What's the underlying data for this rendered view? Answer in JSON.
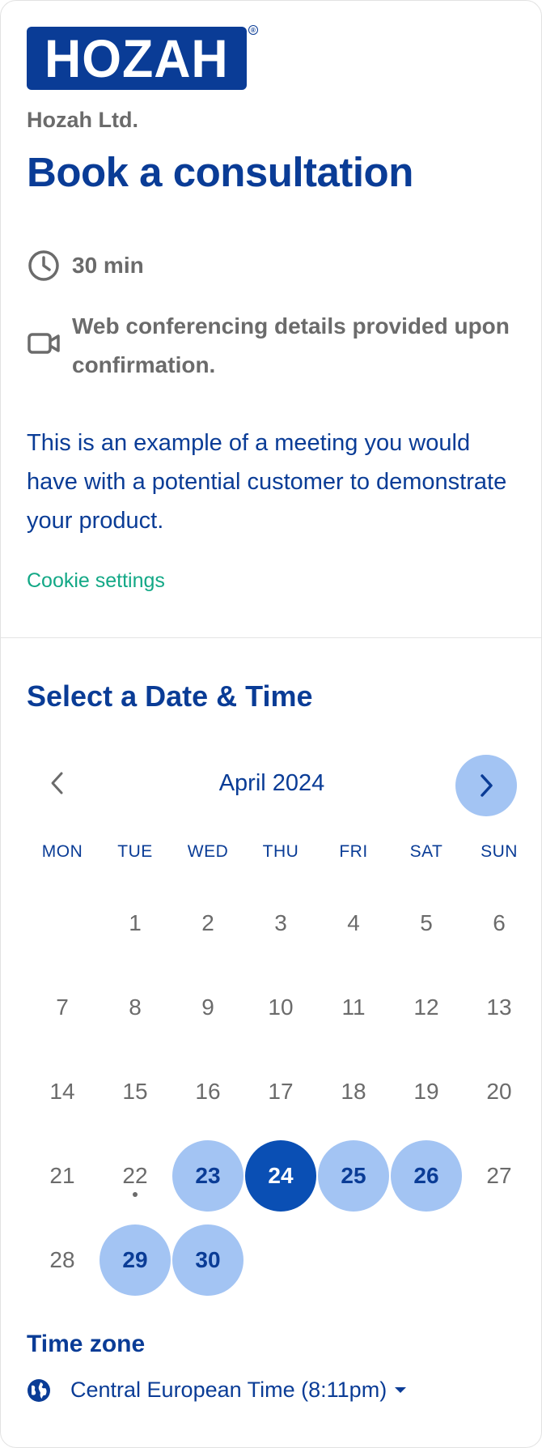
{
  "logo": {
    "text": "HOZAH",
    "reg": "®"
  },
  "organizer": "Hozah Ltd.",
  "event_title": "Book a consultation",
  "duration": {
    "icon": "clock-icon",
    "label": "30 min"
  },
  "location": {
    "icon": "video-camera-icon",
    "label": "Web conferencing details provided upon confirmation."
  },
  "description": "This is an example of a meeting you would have with a potential customer to demonstrate your product.",
  "cookie_link": "Cookie settings",
  "calendar": {
    "heading": "Select a Date & Time",
    "month_label": "April 2024",
    "prev_icon": "chevron-left-icon",
    "next_icon": "chevron-right-icon",
    "weekdays": [
      "MON",
      "TUE",
      "WED",
      "THU",
      "FRI",
      "SAT",
      "SUN"
    ],
    "days": [
      "1",
      "2",
      "3",
      "4",
      "5",
      "6",
      "7",
      "8",
      "9",
      "10",
      "11",
      "12",
      "13",
      "14",
      "15",
      "16",
      "17",
      "18",
      "19",
      "20",
      "21",
      "22",
      "23",
      "24",
      "25",
      "26",
      "27",
      "28",
      "29",
      "30"
    ],
    "first_weekday_index": 1,
    "available_days": [
      "23",
      "25",
      "26",
      "29",
      "30"
    ],
    "selected_day": "24",
    "today": "22"
  },
  "timezone": {
    "heading": "Time zone",
    "icon": "globe-icon",
    "value": "Central European Time (8:11pm)"
  },
  "colors": {
    "brand": "#0a3c96",
    "available": "#a3c4f3",
    "selected": "#0a4fb4",
    "link": "#13a886",
    "muted": "#6b6b6b"
  }
}
